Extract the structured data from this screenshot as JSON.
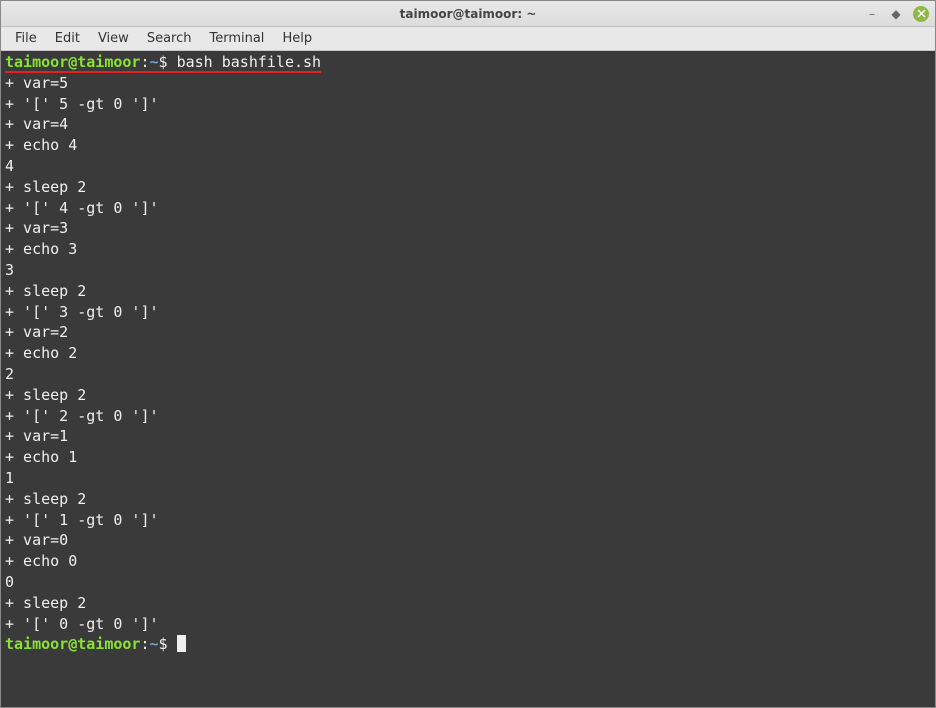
{
  "window": {
    "title": "taimoor@taimoor: ~"
  },
  "menubar": {
    "items": [
      "File",
      "Edit",
      "View",
      "Search",
      "Terminal",
      "Help"
    ]
  },
  "prompt": {
    "user_host": "taimoor@taimoor",
    "separator": ":",
    "path": "~",
    "symbol": "$"
  },
  "command": "bash bashfile.sh",
  "output_lines": [
    "+ var=5",
    "+ '[' 5 -gt 0 ']'",
    "+ var=4",
    "+ echo 4",
    "4",
    "+ sleep 2",
    "+ '[' 4 -gt 0 ']'",
    "+ var=3",
    "+ echo 3",
    "3",
    "+ sleep 2",
    "+ '[' 3 -gt 0 ']'",
    "+ var=2",
    "+ echo 2",
    "2",
    "+ sleep 2",
    "+ '[' 2 -gt 0 ']'",
    "+ var=1",
    "+ echo 1",
    "1",
    "+ sleep 2",
    "+ '[' 1 -gt 0 ']'",
    "+ var=0",
    "+ echo 0",
    "0",
    "+ sleep 2",
    "+ '[' 0 -gt 0 ']'"
  ]
}
